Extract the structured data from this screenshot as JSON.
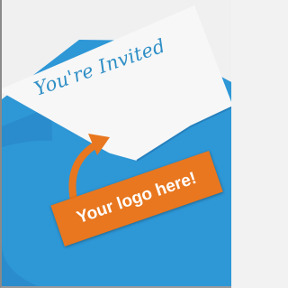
{
  "card": {
    "invitation_text": "You're Invited",
    "logo_placeholder": "Your logo here!"
  },
  "colors": {
    "envelope": "#2e97d6",
    "envelope_shade": "#2580bb",
    "paper": "#f7f7f7",
    "accent_orange": "#e8771f",
    "script_text": "#2f8fc6"
  },
  "icons": {
    "arrow": "curved-arrow-icon"
  }
}
